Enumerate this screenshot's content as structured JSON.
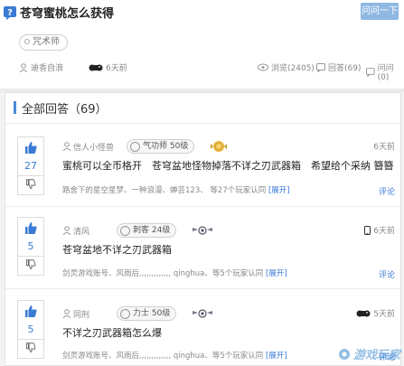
{
  "question": {
    "title": "苍穹蜜桃怎么获得",
    "ask_button": "问问一下",
    "tag": "咒术师",
    "author": "迪香自浪",
    "time": "6天前",
    "views": "浏览(2405)",
    "answers_count": "回答(69)",
    "follow": "问问(0)"
  },
  "answers_section": {
    "header": "全部回答（69）"
  },
  "answers": [
    {
      "votes": "27",
      "user": "信人小怪兽",
      "rank": "气功师 50级",
      "time": "6天前",
      "text": "蜜桃可以全币格开　苍穹盆地怪物掉落不详之刃武器箱　希望给个采纳 簪簪",
      "sub": "路舍下的星空星梦、一种浪漫、蝉芸123、 等27个玩家认同 ",
      "expand": "[展开]",
      "comment": "评论"
    },
    {
      "votes": "5",
      "user": "清风",
      "rank": "刺客 24级",
      "time": "6天前",
      "text": "苍穹盆地不详之刃武器箱",
      "sub": "剑灵游戏账号、风雨后,,,,,,,,,,,,, qinghua、等5个玩家认同 ",
      "expand": "[展开]",
      "comment": "评论"
    },
    {
      "votes": "5",
      "user": "同刑",
      "rank": "力士 50级",
      "time": "5天前",
      "text": "不详之刃武器箱怎么爆",
      "sub": "剑灵游戏账号、风雨后,,,,,,,,,,,,, qinghua、等5个玩家认同 ",
      "expand": "[展开]",
      "comment": "评论"
    }
  ],
  "watermark": "游戏玩家"
}
